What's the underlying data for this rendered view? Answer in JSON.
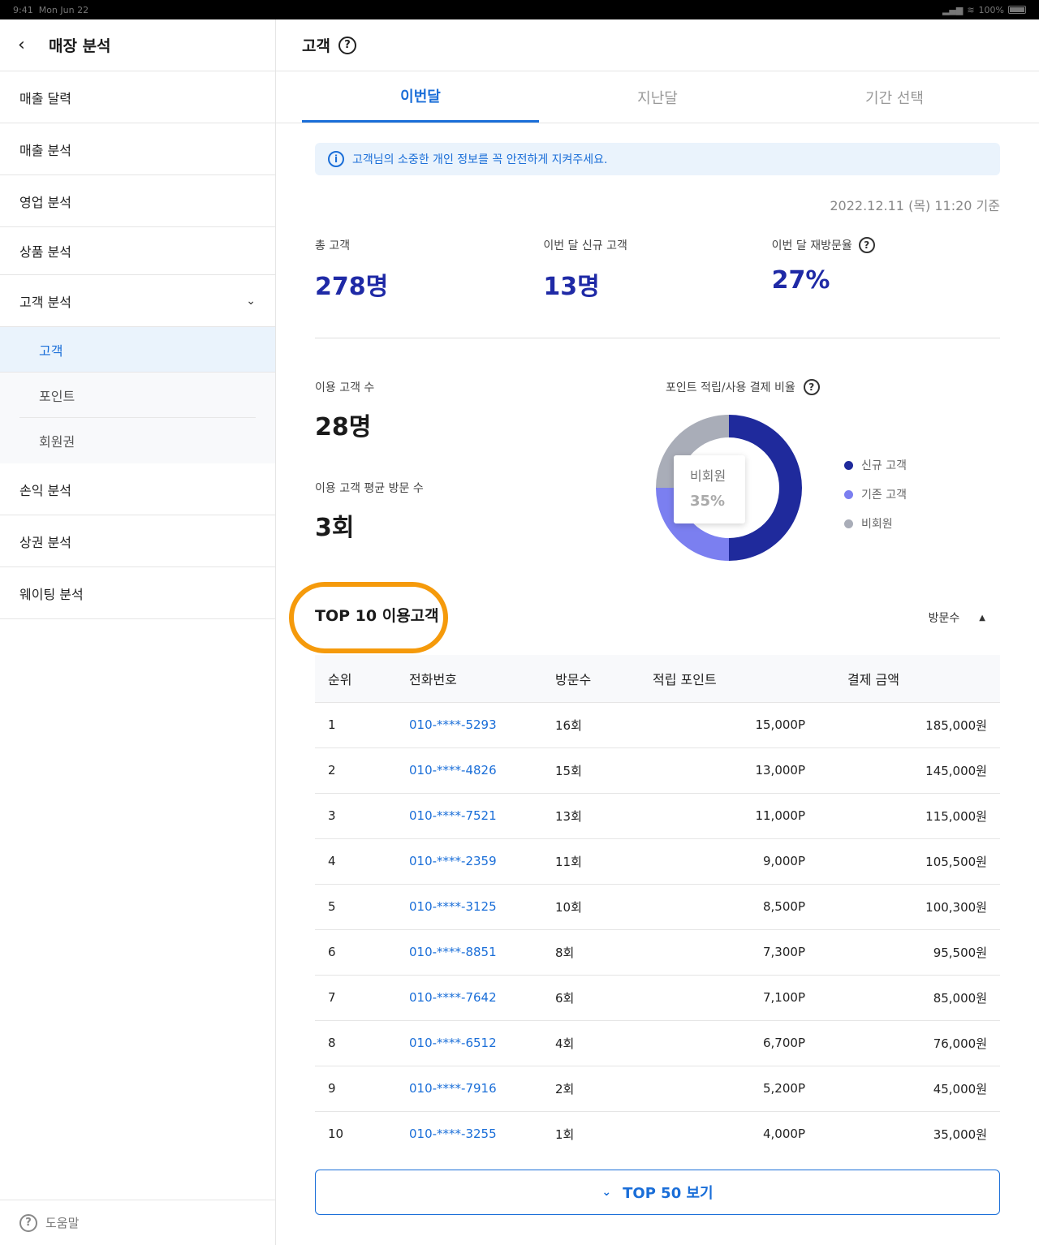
{
  "status_bar": {
    "time": "9:41",
    "date": "Mon Jun 22",
    "battery": "100%"
  },
  "sidebar": {
    "title": "매장 분석",
    "items": [
      {
        "label": "매출 달력"
      },
      {
        "label": "매출 분석"
      },
      {
        "label": "영업 분석"
      },
      {
        "label": "상품 분석"
      },
      {
        "label": "고객 분석"
      }
    ],
    "sub_items": [
      {
        "label": "고객"
      },
      {
        "label": "포인트"
      },
      {
        "label": "회원권"
      }
    ],
    "items_after": [
      {
        "label": "손익 분석"
      },
      {
        "label": "상권 분석"
      },
      {
        "label": "웨이팅 분석"
      }
    ],
    "help_label": "도움말"
  },
  "header": {
    "title": "고객"
  },
  "tabs": [
    {
      "label": "이번달"
    },
    {
      "label": "지난달"
    },
    {
      "label": "기간 선택"
    }
  ],
  "notice": "고객님의 소중한 개인 정보를 꼭 안전하게 지켜주세요.",
  "timestamp": "2022.12.11 (목) 11:20 기준",
  "stats": [
    {
      "label": "총 고객",
      "value": "278명"
    },
    {
      "label": "이번 달 신규 고객",
      "value": "13명"
    },
    {
      "label": "이번 달 재방문율",
      "value": "27%"
    }
  ],
  "usage": {
    "count_label": "이용 고객 수",
    "count_value": "28명",
    "avg_label": "이용 고객 평균 방문 수",
    "avg_value": "3회"
  },
  "chart_data": {
    "type": "pie",
    "title": "포인트 적립/사용 결제 비율",
    "series": [
      {
        "name": "신규 고객",
        "value": 50,
        "color": "#1f2a9c"
      },
      {
        "name": "기존 고객",
        "value": 25,
        "color": "#7b7ff0"
      },
      {
        "name": "비회원",
        "value": 25,
        "color": "#a9adb8"
      }
    ],
    "tooltip": {
      "label": "비회원",
      "value": "35%"
    },
    "legend_position": "right"
  },
  "top": {
    "title": "TOP 10 이용고객",
    "sort_label": "방문수",
    "columns": [
      "순위",
      "전화번호",
      "방문수",
      "적립 포인트",
      "결제 금액"
    ],
    "rows": [
      {
        "rank": "1",
        "phone": "010-****-5293",
        "visits": "16회",
        "points": "15,000P",
        "amount": "185,000원"
      },
      {
        "rank": "2",
        "phone": "010-****-4826",
        "visits": "15회",
        "points": "13,000P",
        "amount": "145,000원"
      },
      {
        "rank": "3",
        "phone": "010-****-7521",
        "visits": "13회",
        "points": "11,000P",
        "amount": "115,000원"
      },
      {
        "rank": "4",
        "phone": "010-****-2359",
        "visits": "11회",
        "points": "9,000P",
        "amount": "105,500원"
      },
      {
        "rank": "5",
        "phone": "010-****-3125",
        "visits": "10회",
        "points": "8,500P",
        "amount": "100,300원"
      },
      {
        "rank": "6",
        "phone": "010-****-8851",
        "visits": "8회",
        "points": "7,300P",
        "amount": "95,500원"
      },
      {
        "rank": "7",
        "phone": "010-****-7642",
        "visits": "6회",
        "points": "7,100P",
        "amount": "85,000원"
      },
      {
        "rank": "8",
        "phone": "010-****-6512",
        "visits": "4회",
        "points": "6,700P",
        "amount": "76,000원"
      },
      {
        "rank": "9",
        "phone": "010-****-7916",
        "visits": "2회",
        "points": "5,200P",
        "amount": "45,000원"
      },
      {
        "rank": "10",
        "phone": "010-****-3255",
        "visits": "1회",
        "points": "4,000P",
        "amount": "35,000원"
      }
    ],
    "more_label": "TOP 50 보기"
  },
  "colors": {
    "accent": "#1a6ed8",
    "stat_value": "#1f2aa6",
    "highlight": "#f59a0b"
  }
}
